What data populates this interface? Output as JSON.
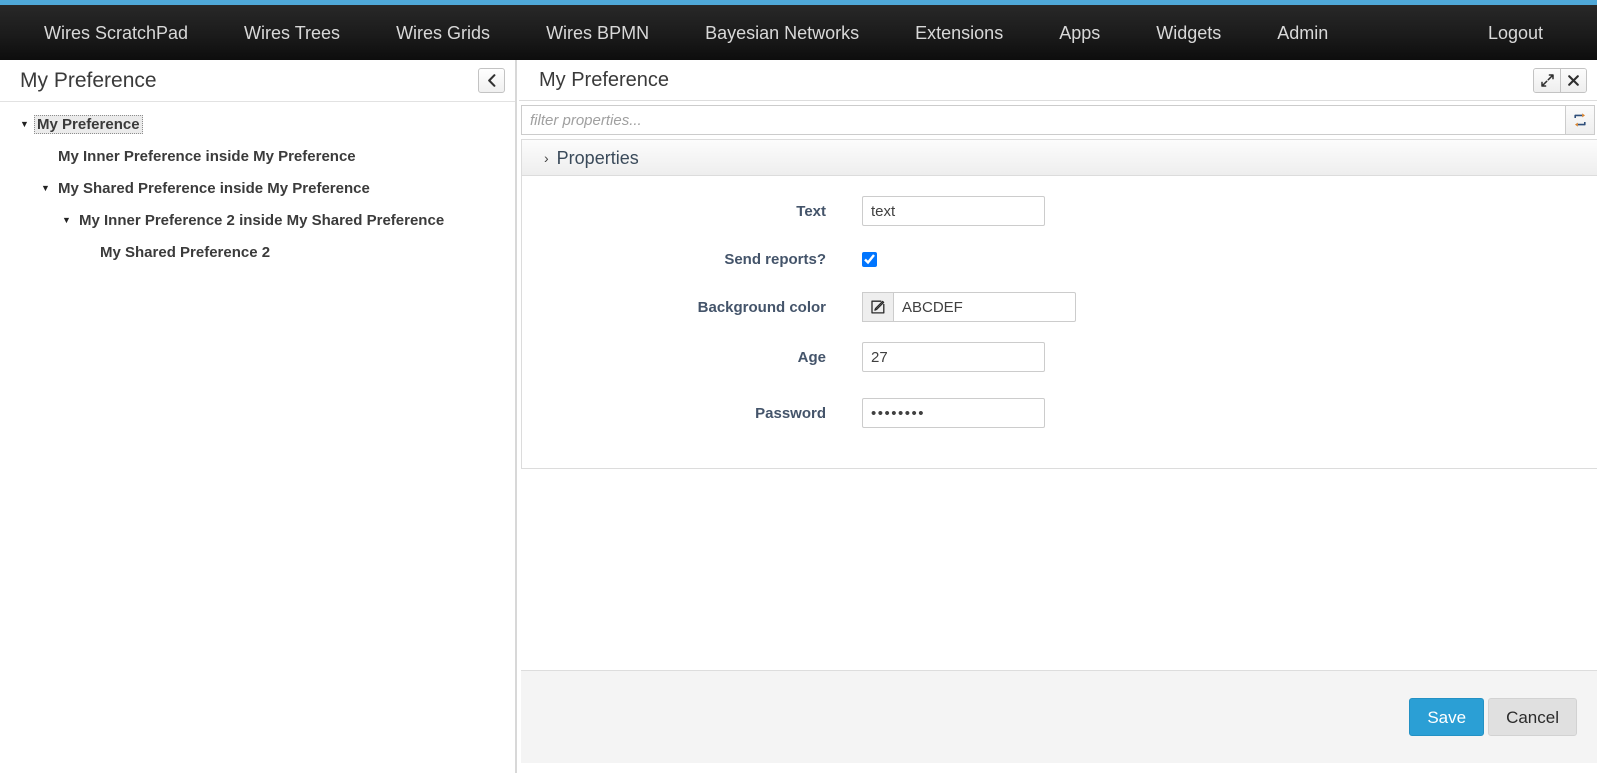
{
  "navbar": {
    "items": [
      {
        "label": "Wires ScratchPad"
      },
      {
        "label": "Wires Trees"
      },
      {
        "label": "Wires Grids"
      },
      {
        "label": "Wires BPMN"
      },
      {
        "label": "Bayesian Networks"
      },
      {
        "label": "Extensions"
      },
      {
        "label": "Apps"
      },
      {
        "label": "Widgets"
      },
      {
        "label": "Admin"
      }
    ],
    "logout_label": "Logout",
    "accent_color": "#4fa8d8",
    "background_color": "#1b1b1b"
  },
  "sidebar": {
    "title": "My Preference",
    "collapse_icon": "chevron-left-icon",
    "tree": [
      {
        "label": "My Preference",
        "depth": 0,
        "expanded": true,
        "selected": true,
        "has_children": true
      },
      {
        "label": "My Inner Preference inside My Preference",
        "depth": 1,
        "expanded": false,
        "selected": false,
        "has_children": false
      },
      {
        "label": "My Shared Preference inside My Preference",
        "depth": 1,
        "expanded": true,
        "selected": false,
        "has_children": true
      },
      {
        "label": "My Inner Preference 2 inside My Shared Preference",
        "depth": 2,
        "expanded": true,
        "selected": false,
        "has_children": true
      },
      {
        "label": "My Shared Preference 2",
        "depth": 3,
        "expanded": false,
        "selected": false,
        "has_children": false
      }
    ]
  },
  "panel": {
    "title": "My Preference",
    "header_buttons": [
      {
        "icon": "expand-icon",
        "label": "↗"
      },
      {
        "icon": "close-icon",
        "label": "✖"
      }
    ],
    "filter": {
      "value": "",
      "placeholder": "filter properties...",
      "refresh_icon": "refresh-icon"
    },
    "properties_section": {
      "chevron_icon": "chevron-right-icon",
      "label": "Properties",
      "fields": [
        {
          "name": "text",
          "label": "Text",
          "type": "text",
          "value": "text"
        },
        {
          "name": "send-reports",
          "label": "Send reports?",
          "type": "checkbox",
          "checked": true
        },
        {
          "name": "background-color",
          "label": "Background color",
          "type": "color-text",
          "value": "ABCDEF",
          "addon_icon": "edit-pencil-icon"
        },
        {
          "name": "age",
          "label": "Age",
          "type": "text",
          "value": "27"
        },
        {
          "name": "password",
          "label": "Password",
          "type": "password",
          "value": "••••••••",
          "masked_length": 8
        }
      ]
    },
    "footer": {
      "save_label": "Save",
      "cancel_label": "Cancel",
      "save_color": "#2b9fd5",
      "cancel_color": "#e0e0e0"
    }
  }
}
